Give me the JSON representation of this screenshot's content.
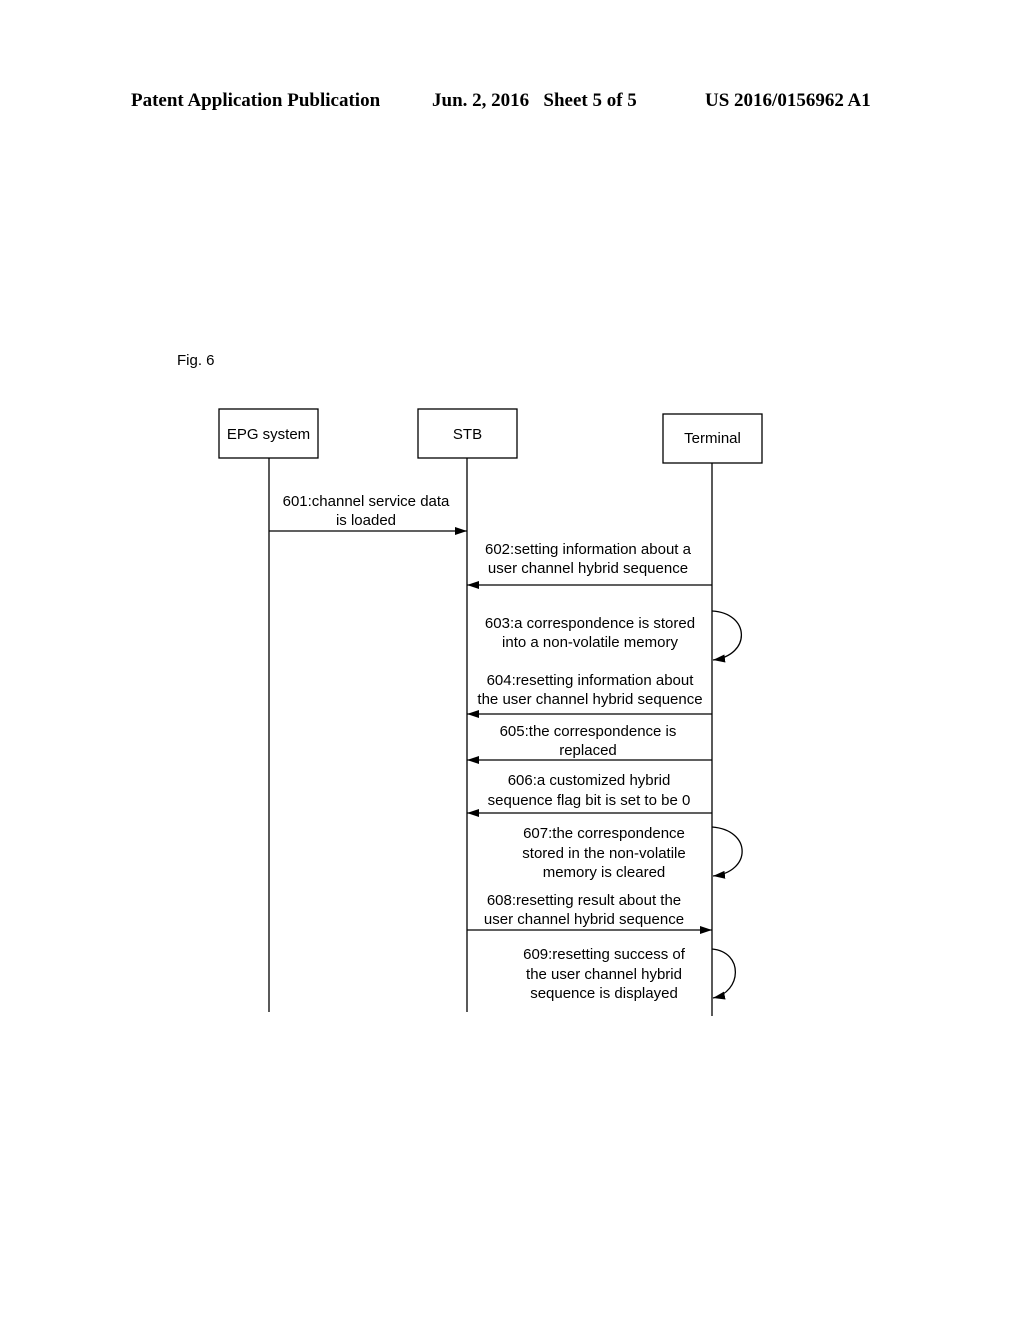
{
  "header": {
    "left": "Patent Application Publication",
    "middle": "Jun. 2, 2016   Sheet 5 of 5",
    "right": "US 2016/0156962 A1"
  },
  "figure": {
    "label": "Fig. 6",
    "actors": [
      {
        "id": "epg",
        "label": "EPG system"
      },
      {
        "id": "stb",
        "label": "STB"
      },
      {
        "id": "terminal",
        "label": "Terminal"
      }
    ],
    "messages": [
      {
        "id": "601",
        "from": "epg",
        "to": "stb",
        "lines": [
          "601:channel service data",
          "is loaded"
        ]
      },
      {
        "id": "602",
        "from": "terminal",
        "to": "stb",
        "lines": [
          "602:setting information about a",
          "user channel hybrid sequence"
        ]
      },
      {
        "id": "603",
        "from": "terminal",
        "to": "terminal",
        "lines": [
          "603:a correspondence is stored",
          "into a non-volatile memory"
        ]
      },
      {
        "id": "604",
        "from": "terminal",
        "to": "stb",
        "lines": [
          "604:resetting information about",
          "the user channel hybrid sequence"
        ]
      },
      {
        "id": "605",
        "from": "terminal",
        "to": "stb",
        "lines": [
          "605:the correspondence is",
          "replaced"
        ]
      },
      {
        "id": "606",
        "from": "terminal",
        "to": "stb",
        "lines": [
          "606:a customized hybrid",
          "sequence flag bit is set to be 0"
        ]
      },
      {
        "id": "607",
        "from": "terminal",
        "to": "terminal",
        "lines": [
          "607:the correspondence",
          "stored in the non-volatile",
          "memory is cleared"
        ]
      },
      {
        "id": "608",
        "from": "stb",
        "to": "terminal",
        "lines": [
          "608:resetting result about the",
          "user channel hybrid sequence"
        ]
      },
      {
        "id": "609",
        "from": "terminal",
        "to": "terminal",
        "lines": [
          "609:resetting success of",
          "the user channel hybrid",
          "sequence is displayed"
        ]
      }
    ]
  }
}
